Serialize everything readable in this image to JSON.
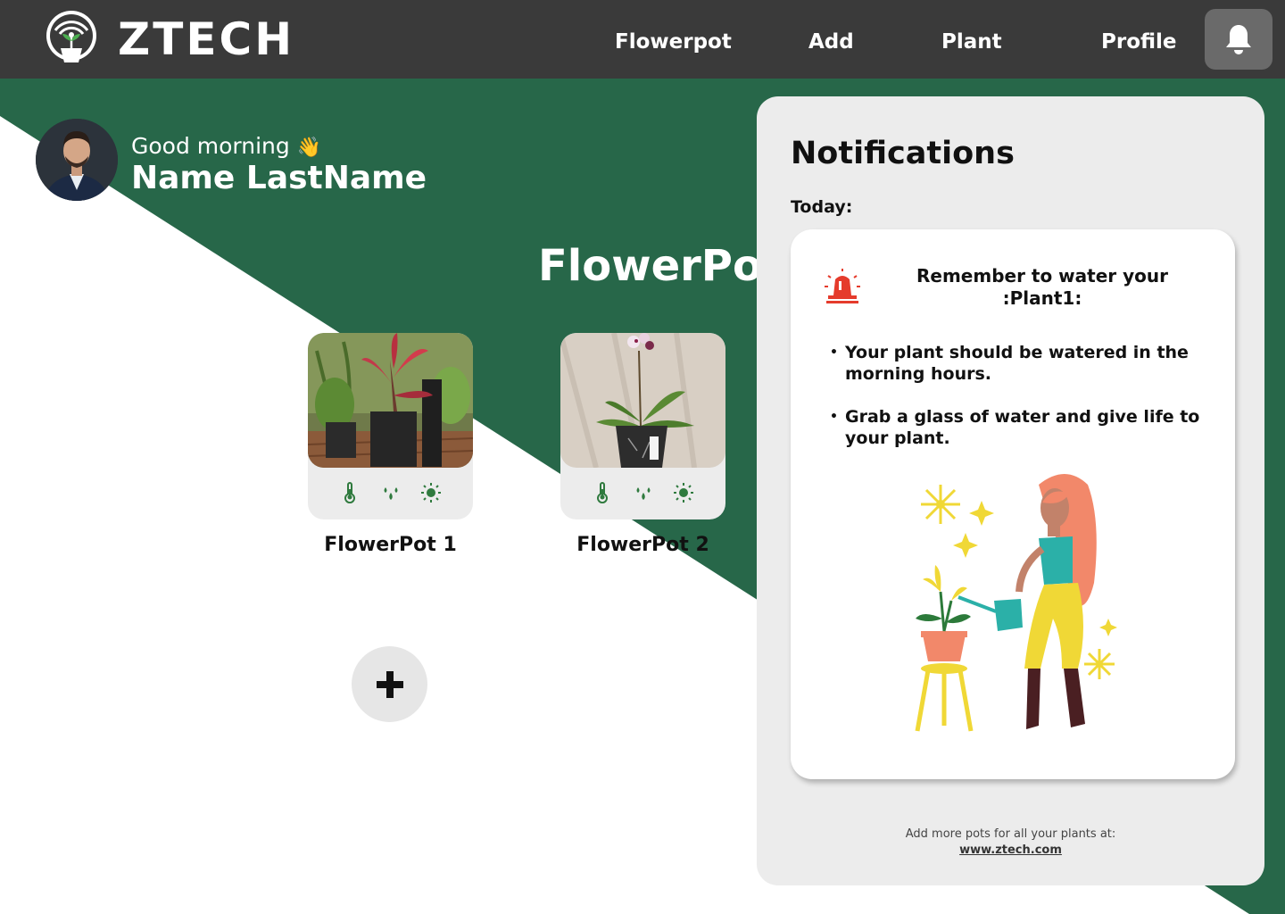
{
  "brand": {
    "name": "ZTECH"
  },
  "nav": {
    "flowerpot": "Flowerpot",
    "add": "Add",
    "plant": "Plant",
    "profile": "Profile"
  },
  "greeting": {
    "salutation": "Good morning",
    "emoji": "👋",
    "user_name": "Name LastName"
  },
  "section_title": "FlowerPots",
  "pots": [
    {
      "label": "FlowerPot 1"
    },
    {
      "label": "FlowerPot 2"
    }
  ],
  "notifications": {
    "title": "Notifications",
    "today_label": "Today:",
    "card": {
      "heading": "Remember to water your :Plant1:",
      "tips": [
        "Your plant should be watered in the morning hours.",
        "Grab a glass of water and give life to your plant."
      ]
    },
    "footer_text": "Add more pots for all your plants at:",
    "footer_link": "www.ztech.com"
  },
  "colors": {
    "header": "#3a3a3a",
    "accent_green": "#276749",
    "panel": "#ececec",
    "sensor_icon": "#2f7a3e",
    "alarm_red": "#e53b2c"
  },
  "icons": {
    "logo": "plant-wifi-logo-icon",
    "bell": "bell-icon",
    "sensors": [
      "thermometer-icon",
      "water-drops-icon",
      "sun-icon"
    ],
    "add": "plus-icon",
    "alarm": "alarm-siren-icon"
  }
}
